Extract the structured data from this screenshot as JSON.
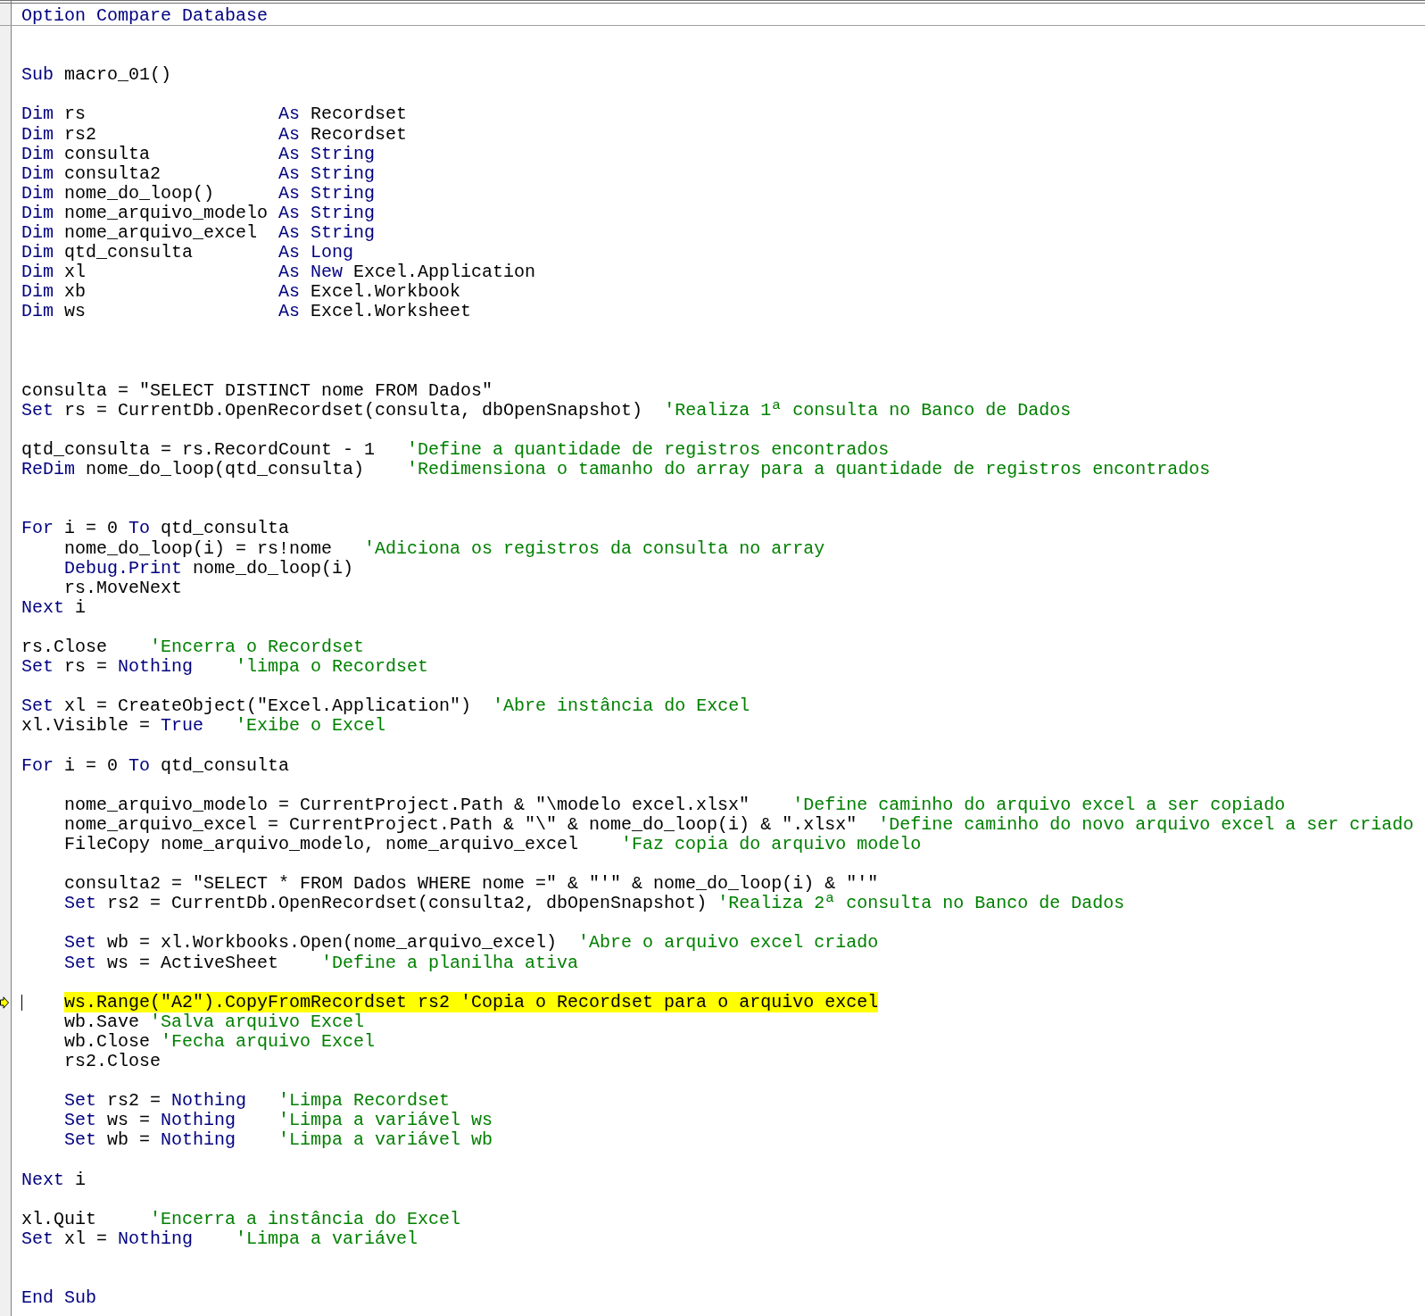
{
  "lines": [
    {
      "kind": "code",
      "indented": false,
      "highlighted": false,
      "separator_below": true,
      "segments": [
        {
          "kind": "keyword",
          "text": "Option Compare Database"
        }
      ]
    },
    {
      "kind": "blank"
    },
    {
      "kind": "blank"
    },
    {
      "kind": "code",
      "indented": false,
      "highlighted": false,
      "segments": [
        {
          "kind": "keyword",
          "text": "Sub"
        },
        {
          "kind": "code",
          "text": " macro_01()"
        }
      ]
    },
    {
      "kind": "blank"
    },
    {
      "kind": "code",
      "indented": false,
      "highlighted": false,
      "segments": [
        {
          "kind": "keyword",
          "text": "Dim"
        },
        {
          "kind": "code",
          "text": " rs                  "
        },
        {
          "kind": "keyword",
          "text": "As"
        },
        {
          "kind": "code",
          "text": " Recordset"
        }
      ]
    },
    {
      "kind": "code",
      "indented": false,
      "highlighted": false,
      "segments": [
        {
          "kind": "keyword",
          "text": "Dim"
        },
        {
          "kind": "code",
          "text": " rs2                 "
        },
        {
          "kind": "keyword",
          "text": "As"
        },
        {
          "kind": "code",
          "text": " Recordset"
        }
      ]
    },
    {
      "kind": "code",
      "indented": false,
      "highlighted": false,
      "segments": [
        {
          "kind": "keyword",
          "text": "Dim"
        },
        {
          "kind": "code",
          "text": " consulta            "
        },
        {
          "kind": "keyword",
          "text": "As String"
        }
      ]
    },
    {
      "kind": "code",
      "indented": false,
      "highlighted": false,
      "segments": [
        {
          "kind": "keyword",
          "text": "Dim"
        },
        {
          "kind": "code",
          "text": " consulta2           "
        },
        {
          "kind": "keyword",
          "text": "As String"
        }
      ]
    },
    {
      "kind": "code",
      "indented": false,
      "highlighted": false,
      "segments": [
        {
          "kind": "keyword",
          "text": "Dim"
        },
        {
          "kind": "code",
          "text": " nome_do_loop()      "
        },
        {
          "kind": "keyword",
          "text": "As String"
        }
      ]
    },
    {
      "kind": "code",
      "indented": false,
      "highlighted": false,
      "segments": [
        {
          "kind": "keyword",
          "text": "Dim"
        },
        {
          "kind": "code",
          "text": " nome_arquivo_modelo "
        },
        {
          "kind": "keyword",
          "text": "As String"
        }
      ]
    },
    {
      "kind": "code",
      "indented": false,
      "highlighted": false,
      "segments": [
        {
          "kind": "keyword",
          "text": "Dim"
        },
        {
          "kind": "code",
          "text": " nome_arquivo_excel  "
        },
        {
          "kind": "keyword",
          "text": "As String"
        }
      ]
    },
    {
      "kind": "code",
      "indented": false,
      "highlighted": false,
      "segments": [
        {
          "kind": "keyword",
          "text": "Dim"
        },
        {
          "kind": "code",
          "text": " qtd_consulta        "
        },
        {
          "kind": "keyword",
          "text": "As Long"
        }
      ]
    },
    {
      "kind": "code",
      "indented": false,
      "highlighted": false,
      "segments": [
        {
          "kind": "keyword",
          "text": "Dim"
        },
        {
          "kind": "code",
          "text": " xl                  "
        },
        {
          "kind": "keyword",
          "text": "As New"
        },
        {
          "kind": "code",
          "text": " Excel.Application"
        }
      ]
    },
    {
      "kind": "code",
      "indented": false,
      "highlighted": false,
      "segments": [
        {
          "kind": "keyword",
          "text": "Dim"
        },
        {
          "kind": "code",
          "text": " xb                  "
        },
        {
          "kind": "keyword",
          "text": "As"
        },
        {
          "kind": "code",
          "text": " Excel.Workbook"
        }
      ]
    },
    {
      "kind": "code",
      "indented": false,
      "highlighted": false,
      "segments": [
        {
          "kind": "keyword",
          "text": "Dim"
        },
        {
          "kind": "code",
          "text": " ws                  "
        },
        {
          "kind": "keyword",
          "text": "As"
        },
        {
          "kind": "code",
          "text": " Excel.Worksheet"
        }
      ]
    },
    {
      "kind": "blank"
    },
    {
      "kind": "blank"
    },
    {
      "kind": "blank"
    },
    {
      "kind": "code",
      "indented": false,
      "highlighted": false,
      "segments": [
        {
          "kind": "code",
          "text": "consulta = \"SELECT DISTINCT nome FROM Dados\""
        }
      ]
    },
    {
      "kind": "code",
      "indented": false,
      "highlighted": false,
      "segments": [
        {
          "kind": "keyword",
          "text": "Set"
        },
        {
          "kind": "code",
          "text": " rs = CurrentDb.OpenRecordset(consulta, dbOpenSnapshot)  "
        },
        {
          "kind": "comment",
          "text": "'Realiza 1ª consulta no Banco de Dados"
        }
      ]
    },
    {
      "kind": "blank"
    },
    {
      "kind": "code",
      "indented": false,
      "highlighted": false,
      "segments": [
        {
          "kind": "code",
          "text": "qtd_consulta = rs.RecordCount - 1   "
        },
        {
          "kind": "comment",
          "text": "'Define a quantidade de registros encontrados"
        }
      ]
    },
    {
      "kind": "code",
      "indented": false,
      "highlighted": false,
      "segments": [
        {
          "kind": "keyword",
          "text": "ReDim"
        },
        {
          "kind": "code",
          "text": " nome_do_loop(qtd_consulta)    "
        },
        {
          "kind": "comment",
          "text": "'Redimensiona o tamanho do array para a quantidade de registros encontrados"
        }
      ]
    },
    {
      "kind": "blank"
    },
    {
      "kind": "blank"
    },
    {
      "kind": "code",
      "indented": false,
      "highlighted": false,
      "segments": [
        {
          "kind": "keyword",
          "text": "For"
        },
        {
          "kind": "code",
          "text": " i = 0 "
        },
        {
          "kind": "keyword",
          "text": "To"
        },
        {
          "kind": "code",
          "text": " qtd_consulta"
        }
      ]
    },
    {
      "kind": "code",
      "indented": true,
      "highlighted": false,
      "segments": [
        {
          "kind": "code",
          "text": "nome_do_loop(i) = rs!nome   "
        },
        {
          "kind": "comment",
          "text": "'Adiciona os registros da consulta no array"
        }
      ]
    },
    {
      "kind": "code",
      "indented": true,
      "highlighted": false,
      "segments": [
        {
          "kind": "keyword",
          "text": "Debug.Print"
        },
        {
          "kind": "code",
          "text": " nome_do_loop(i)"
        }
      ]
    },
    {
      "kind": "code",
      "indented": true,
      "highlighted": false,
      "segments": [
        {
          "kind": "code",
          "text": "rs.MoveNext"
        }
      ]
    },
    {
      "kind": "code",
      "indented": false,
      "highlighted": false,
      "segments": [
        {
          "kind": "keyword",
          "text": "Next"
        },
        {
          "kind": "code",
          "text": " i"
        }
      ]
    },
    {
      "kind": "blank"
    },
    {
      "kind": "code",
      "indented": false,
      "highlighted": false,
      "segments": [
        {
          "kind": "code",
          "text": "rs.Close    "
        },
        {
          "kind": "comment",
          "text": "'Encerra o Recordset"
        }
      ]
    },
    {
      "kind": "code",
      "indented": false,
      "highlighted": false,
      "segments": [
        {
          "kind": "keyword",
          "text": "Set"
        },
        {
          "kind": "code",
          "text": " rs = "
        },
        {
          "kind": "keyword",
          "text": "Nothing"
        },
        {
          "kind": "comment",
          "text": "    'limpa o Recordset"
        }
      ]
    },
    {
      "kind": "blank"
    },
    {
      "kind": "code",
      "indented": false,
      "highlighted": false,
      "segments": [
        {
          "kind": "keyword",
          "text": "Set"
        },
        {
          "kind": "code",
          "text": " xl = CreateObject(\"Excel.Application\")  "
        },
        {
          "kind": "comment",
          "text": "'Abre instância do Excel"
        }
      ]
    },
    {
      "kind": "code",
      "indented": false,
      "highlighted": false,
      "segments": [
        {
          "kind": "code",
          "text": "xl.Visible = "
        },
        {
          "kind": "keyword",
          "text": "True"
        },
        {
          "kind": "comment",
          "text": "   'Exibe o Excel"
        }
      ]
    },
    {
      "kind": "blank"
    },
    {
      "kind": "code",
      "indented": false,
      "highlighted": false,
      "segments": [
        {
          "kind": "keyword",
          "text": "For"
        },
        {
          "kind": "code",
          "text": " i = 0 "
        },
        {
          "kind": "keyword",
          "text": "To"
        },
        {
          "kind": "code",
          "text": " qtd_consulta"
        }
      ]
    },
    {
      "kind": "blank"
    },
    {
      "kind": "code",
      "indented": true,
      "highlighted": false,
      "segments": [
        {
          "kind": "code",
          "text": "nome_arquivo_modelo = CurrentProject.Path & \"\\modelo excel.xlsx\"    "
        },
        {
          "kind": "comment",
          "text": "'Define caminho do arquivo excel a ser copiado"
        }
      ]
    },
    {
      "kind": "code",
      "indented": true,
      "highlighted": false,
      "segments": [
        {
          "kind": "code",
          "text": "nome_arquivo_excel = CurrentProject.Path & \"\\\" & nome_do_loop(i) & \".xlsx\"  "
        },
        {
          "kind": "comment",
          "text": "'Define caminho do novo arquivo excel a ser criado"
        }
      ]
    },
    {
      "kind": "code",
      "indented": true,
      "highlighted": false,
      "segments": [
        {
          "kind": "code",
          "text": "FileCopy nome_arquivo_modelo, nome_arquivo_excel    "
        },
        {
          "kind": "comment",
          "text": "'Faz copia do arquivo modelo"
        }
      ]
    },
    {
      "kind": "blank"
    },
    {
      "kind": "code",
      "indented": true,
      "highlighted": false,
      "segments": [
        {
          "kind": "code",
          "text": "consulta2 = \"SELECT * FROM Dados WHERE nome =\" & \"'\" & nome_do_loop(i) & \"'\""
        }
      ]
    },
    {
      "kind": "code",
      "indented": true,
      "highlighted": false,
      "segments": [
        {
          "kind": "keyword",
          "text": "Set"
        },
        {
          "kind": "code",
          "text": " rs2 = CurrentDb.OpenRecordset(consulta2, dbOpenSnapshot) "
        },
        {
          "kind": "comment",
          "text": "'Realiza 2ª consulta no Banco de Dados"
        }
      ]
    },
    {
      "kind": "blank"
    },
    {
      "kind": "code",
      "indented": true,
      "highlighted": false,
      "segments": [
        {
          "kind": "keyword",
          "text": "Set"
        },
        {
          "kind": "code",
          "text": " wb = xl.Workbooks.Open(nome_arquivo_excel)  "
        },
        {
          "kind": "comment",
          "text": "'Abre o arquivo excel criado"
        }
      ]
    },
    {
      "kind": "code",
      "indented": true,
      "highlighted": false,
      "segments": [
        {
          "kind": "keyword",
          "text": "Set"
        },
        {
          "kind": "code",
          "text": " ws = ActiveSheet    "
        },
        {
          "kind": "comment",
          "text": "'Define a planilha ativa"
        }
      ]
    },
    {
      "kind": "blank"
    },
    {
      "kind": "code",
      "indented": true,
      "highlighted": true,
      "segments": [
        {
          "kind": "code",
          "text": "ws.Range(\"A2\").CopyFromRecordset rs2 "
        },
        {
          "kind": "comment",
          "text": "'Copia o Recordset para o arquivo excel"
        }
      ]
    },
    {
      "kind": "code",
      "indented": true,
      "highlighted": false,
      "segments": [
        {
          "kind": "code",
          "text": "wb.Save "
        },
        {
          "kind": "comment",
          "text": "'Salva arquivo Excel"
        }
      ]
    },
    {
      "kind": "code",
      "indented": true,
      "highlighted": false,
      "segments": [
        {
          "kind": "code",
          "text": "wb.Close "
        },
        {
          "kind": "comment",
          "text": "'Fecha arquivo Excel"
        }
      ]
    },
    {
      "kind": "code",
      "indented": true,
      "highlighted": false,
      "segments": [
        {
          "kind": "code",
          "text": "rs2.Close"
        }
      ]
    },
    {
      "kind": "blank"
    },
    {
      "kind": "code",
      "indented": true,
      "highlighted": false,
      "segments": [
        {
          "kind": "keyword",
          "text": "Set"
        },
        {
          "kind": "code",
          "text": " rs2 = "
        },
        {
          "kind": "keyword",
          "text": "Nothing"
        },
        {
          "kind": "comment",
          "text": "   'Limpa Recordset"
        }
      ]
    },
    {
      "kind": "code",
      "indented": true,
      "highlighted": false,
      "segments": [
        {
          "kind": "keyword",
          "text": "Set"
        },
        {
          "kind": "code",
          "text": " ws = "
        },
        {
          "kind": "keyword",
          "text": "Nothing"
        },
        {
          "kind": "comment",
          "text": "    'Limpa a variável ws"
        }
      ]
    },
    {
      "kind": "code",
      "indented": true,
      "highlighted": false,
      "segments": [
        {
          "kind": "keyword",
          "text": "Set"
        },
        {
          "kind": "code",
          "text": " wb = "
        },
        {
          "kind": "keyword",
          "text": "Nothing"
        },
        {
          "kind": "comment",
          "text": "    'Limpa a variável wb"
        }
      ]
    },
    {
      "kind": "blank"
    },
    {
      "kind": "code",
      "indented": false,
      "highlighted": false,
      "segments": [
        {
          "kind": "keyword",
          "text": "Next"
        },
        {
          "kind": "code",
          "text": " i"
        }
      ]
    },
    {
      "kind": "blank"
    },
    {
      "kind": "code",
      "indented": false,
      "highlighted": false,
      "segments": [
        {
          "kind": "code",
          "text": "xl.Quit     "
        },
        {
          "kind": "comment",
          "text": "'Encerra a instância do Excel"
        }
      ]
    },
    {
      "kind": "code",
      "indented": false,
      "highlighted": false,
      "segments": [
        {
          "kind": "keyword",
          "text": "Set"
        },
        {
          "kind": "code",
          "text": " xl = "
        },
        {
          "kind": "keyword",
          "text": "Nothing"
        },
        {
          "kind": "comment",
          "text": "    'Limpa a variável"
        }
      ]
    },
    {
      "kind": "blank"
    },
    {
      "kind": "blank"
    },
    {
      "kind": "code",
      "indented": false,
      "highlighted": false,
      "segments": [
        {
          "kind": "keyword",
          "text": "End Sub"
        }
      ]
    }
  ]
}
